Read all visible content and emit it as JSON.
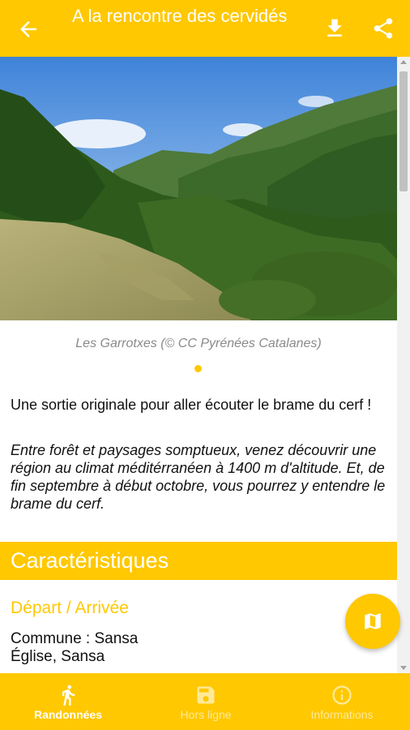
{
  "app_bar": {
    "title": "A la rencontre des cervidés",
    "back_icon": "arrow-left",
    "download_icon": "download",
    "share_icon": "share"
  },
  "hero": {
    "caption": "Les Garrotxes (© CC Pyrénées Catalanes)",
    "slide_count": 1,
    "active_slide": 1
  },
  "intro": "Une sortie originale pour aller écouter le brame du cerf !",
  "description": "Entre forêt et paysages somptueux, venez découvrir une région au climat méditérranéen à 1400 m d'altitude. Et, de fin septembre à début octobre, vous pourrez y entendre le brame du cerf.",
  "characteristics": {
    "heading": "Caractéristiques",
    "departure_label": "Départ / Arrivée",
    "commune_line": "Commune : Sansa",
    "place_line": "Église, Sansa"
  },
  "fab": {
    "icon": "map"
  },
  "bottom_nav": {
    "items": [
      {
        "label": "Randonnées",
        "icon": "hiker",
        "active": true
      },
      {
        "label": "Hors ligne",
        "icon": "floppy-disk",
        "active": false
      },
      {
        "label": "Informations",
        "icon": "info",
        "active": false
      }
    ]
  },
  "colors": {
    "accent": "#ffc800",
    "on_accent": "#ffffff",
    "caption": "#8a8a8a"
  }
}
